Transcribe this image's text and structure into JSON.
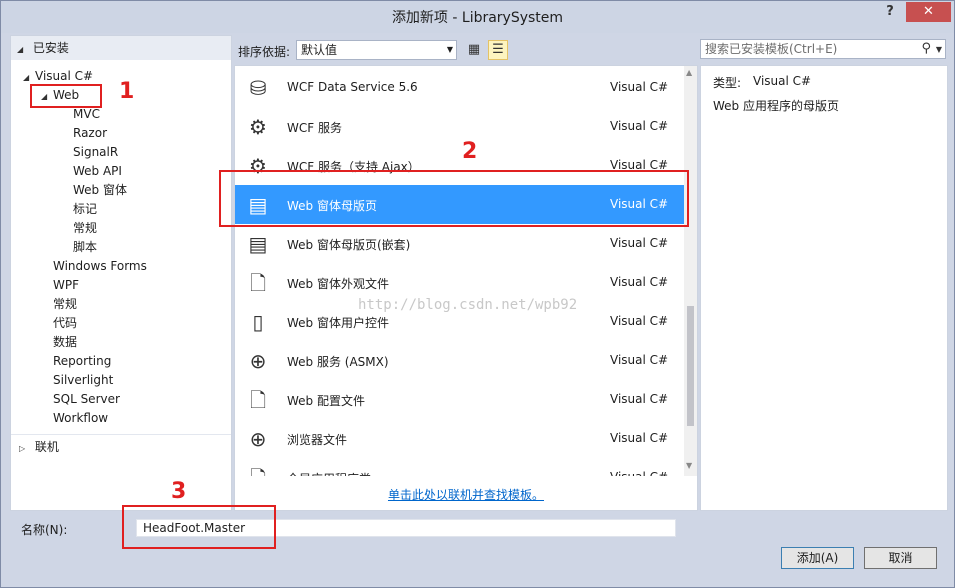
{
  "window": {
    "title": "添加新项 - LibrarySystem",
    "help": "?",
    "close": "✕"
  },
  "left": {
    "header": "已安装",
    "tree": [
      {
        "label": "Visual C#",
        "arrow": "◢",
        "indent": 1
      },
      {
        "label": "Web",
        "arrow": "◢",
        "indent": 2
      },
      {
        "label": "MVC",
        "indent": 3
      },
      {
        "label": "Razor",
        "indent": 3
      },
      {
        "label": "SignalR",
        "indent": 3
      },
      {
        "label": "Web API",
        "indent": 3
      },
      {
        "label": "Web 窗体",
        "indent": 3
      },
      {
        "label": "标记",
        "indent": 3
      },
      {
        "label": "常规",
        "indent": 3
      },
      {
        "label": "脚本",
        "indent": 3
      },
      {
        "label": "Windows Forms",
        "indent": 2
      },
      {
        "label": "WPF",
        "indent": 2
      },
      {
        "label": "常规",
        "indent": 2
      },
      {
        "label": "代码",
        "indent": 2
      },
      {
        "label": "数据",
        "indent": 2
      },
      {
        "label": "Reporting",
        "indent": 2
      },
      {
        "label": "Silverlight",
        "indent": 2
      },
      {
        "label": "SQL Server",
        "indent": 2
      },
      {
        "label": "Workflow",
        "indent": 2
      }
    ],
    "online": {
      "label": "联机",
      "arrow": "▷"
    }
  },
  "toolbar": {
    "sort_label": "排序依据:",
    "sort_value": "默认值",
    "grid_icon": "grid-view-icon",
    "list_icon": "list-view-icon"
  },
  "items": [
    {
      "name": "WCF Data Service 5.6",
      "lang": "Visual C#",
      "icon": "⛁"
    },
    {
      "name": "WCF 服务",
      "lang": "Visual C#",
      "icon": "⚙"
    },
    {
      "name": "WCF 服务（支持 Ajax）",
      "lang": "Visual C#",
      "icon": "⚙"
    },
    {
      "name": "Web 窗体母版页",
      "lang": "Visual C#",
      "icon": "▤",
      "selected": true
    },
    {
      "name": "Web 窗体母版页(嵌套)",
      "lang": "Visual C#",
      "icon": "▤"
    },
    {
      "name": "Web 窗体外观文件",
      "lang": "Visual C#",
      "icon": "🗋"
    },
    {
      "name": "Web 窗体用户控件",
      "lang": "Visual C#",
      "icon": "▯"
    },
    {
      "name": "Web 服务 (ASMX)",
      "lang": "Visual C#",
      "icon": "⊕"
    },
    {
      "name": "Web 配置文件",
      "lang": "Visual C#",
      "icon": "🗋"
    },
    {
      "name": "浏览器文件",
      "lang": "Visual C#",
      "icon": "⊕"
    },
    {
      "name": "全局应用程序类",
      "lang": "Visual C#",
      "icon": "🗋"
    }
  ],
  "online_link": "单击此处以联机并查找模板。",
  "search": {
    "placeholder": "搜索已安装模板(Ctrl+E)"
  },
  "details": {
    "type_label": "类型:",
    "type_value": "Visual C#",
    "description": "Web 应用程序的母版页"
  },
  "bottom": {
    "name_label": "名称(N):",
    "name_value": "HeadFoot.Master",
    "add_label": "添加(A)",
    "cancel_label": "取消"
  },
  "annotations": {
    "n1": "1",
    "n2": "2",
    "n3": "3",
    "watermark": "http://blog.csdn.net/wpb92"
  },
  "colors": {
    "selection": "#3399ff",
    "annotation": "#e02020",
    "link": "#0066cc"
  }
}
